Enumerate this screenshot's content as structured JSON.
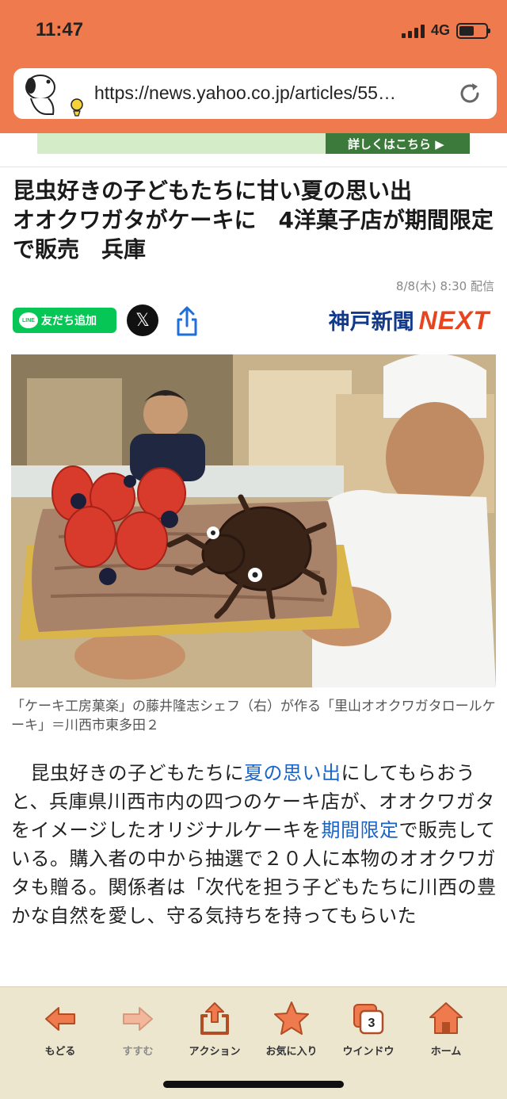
{
  "status_bar": {
    "time": "11:47",
    "network": "4G",
    "battery_level": 0.55
  },
  "browser": {
    "url": "https://news.yahoo.co.jp/articles/55…"
  },
  "ad": {
    "cta_label": "詳しくはこちら ▶"
  },
  "article": {
    "headline": "昆虫好きの子どもたちに甘い夏の思い出\nオオクワガタがケーキに　4洋菓子店が期間限定で販売　兵庫",
    "date": "8/8(木) 8:30 配信",
    "share": {
      "line_label": "友だち追加",
      "line_icon_text": "LINE",
      "x_label": "𝕏"
    },
    "publisher": {
      "name_jp": "神戸新聞",
      "name_en": "NEXT"
    },
    "photo_caption": "「ケーキ工房菓楽」の藤井隆志シェフ（右）が作る「里山オオクワガタロールケーキ」＝川西市東多田２",
    "body": {
      "p1_a": "　昆虫好きの子どもたちに",
      "link1": "夏の思い出",
      "p1_b": "にしてもらおうと、兵庫県川西市内の四つのケーキ店が、オオクワガタをイメージしたオリジナルケーキを",
      "link2": "期間限定",
      "p1_c": "で販売している。購入者の中から抽選で２０人に本物のオオクワガタも贈る。関係者は「次代を担う子どもたちに川西の豊かな自然を愛し、守る気持ちを持ってもらいた"
    }
  },
  "toolbar": {
    "back": "もどる",
    "forward": "すすむ",
    "action": "アクション",
    "favorites": "お気に入り",
    "windows": "ウインドウ",
    "window_count": "3",
    "home": "ホーム"
  },
  "colors": {
    "accent": "#ee7a4d",
    "link": "#1a64c8",
    "line_green": "#06c755",
    "toolbar_bg": "#ece6cf"
  }
}
